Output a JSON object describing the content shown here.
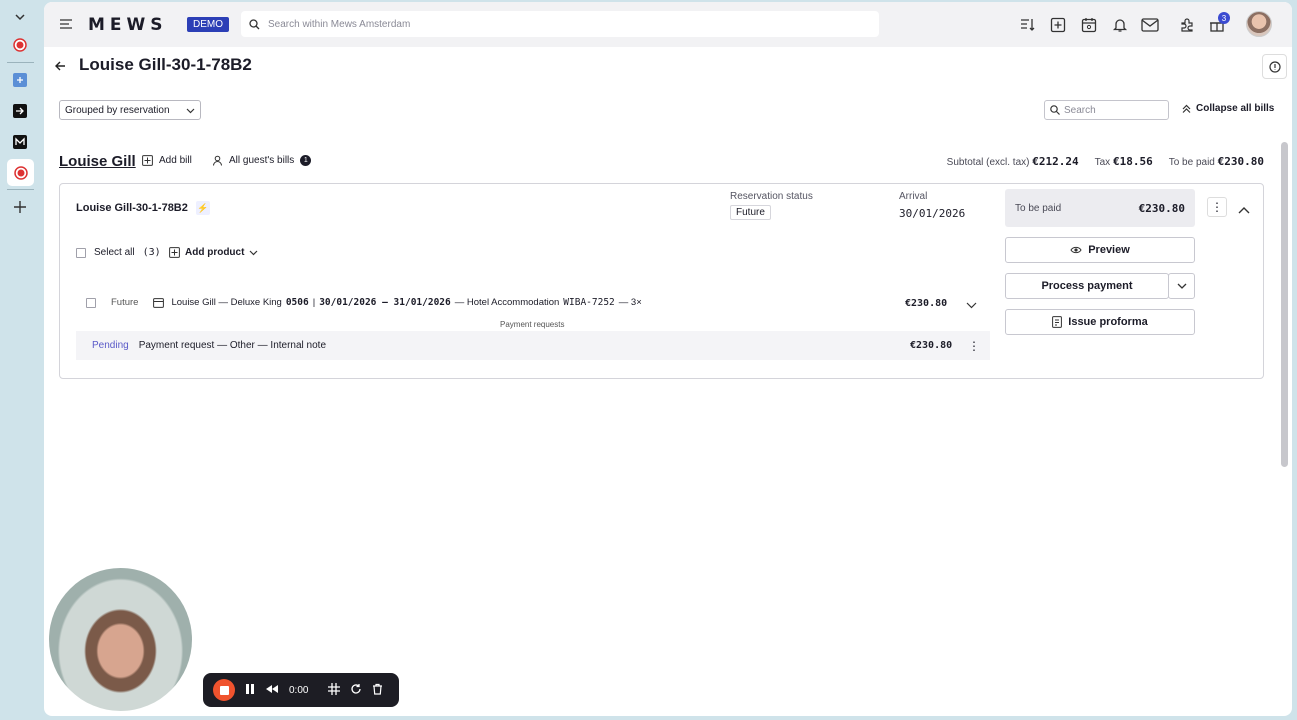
{
  "dock": {
    "icons": [
      "chevron-down-icon",
      "record-icon",
      "app-icon",
      "arrow-icon",
      "gmail-icon",
      "record-active-icon",
      "plus-icon"
    ]
  },
  "topbar": {
    "logo": "MEWS",
    "demo_badge": "DEMO",
    "search_placeholder": "Search within Mews Amsterdam",
    "notification_count": "3"
  },
  "page": {
    "title": "Louise Gill-30-1-78B2"
  },
  "toolbar": {
    "group_select": "Grouped by reservation",
    "search_placeholder": "Search",
    "collapse_label": "Collapse all bills"
  },
  "guest": {
    "name": "Louise Gill",
    "add_bill": "Add bill",
    "all_bills": "All guest's bills",
    "bill_count": "1",
    "subtotal_label": "Subtotal (excl. tax)",
    "subtotal_value": "€212.24",
    "tax_label": "Tax",
    "tax_value": "€18.56",
    "to_pay_label": "To be paid",
    "to_pay_value": "€230.80"
  },
  "bill": {
    "reservation_name": "Louise Gill-30-1-78B2",
    "status_label": "Reservation status",
    "status_value": "Future",
    "arrival_label": "Arrival",
    "arrival_value": "30/01/2026",
    "paybox_label": "To be paid",
    "paybox_value": "€230.80",
    "select_all": "Select all",
    "select_count": "(3)",
    "add_product": "Add product",
    "preview_btn": "Preview",
    "process_btn": "Process payment",
    "proforma_btn": "Issue proforma",
    "item": {
      "status": "Future",
      "text_a": "Louise Gill — Deluxe King",
      "room": "0506",
      "sep": "|",
      "dates": "30/01/2026 — 31/01/2026",
      "text_b": "— Hotel Accommodation",
      "code": "WIBA-7252",
      "qty": "— 3×",
      "amount": "€230.80"
    },
    "payment_requests_label": "Payment requests",
    "request": {
      "status": "Pending",
      "text": "Payment request — Other — Internal note",
      "amount": "€230.80"
    }
  },
  "recorder": {
    "time": "0:00"
  }
}
